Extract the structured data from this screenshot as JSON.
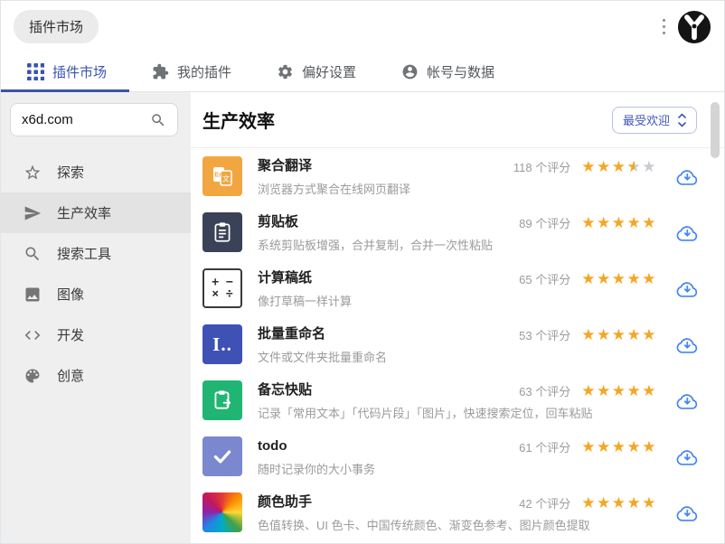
{
  "colors": {
    "accent_blue": "#3A55AD",
    "sort_blue": "#4059B8",
    "star_orange": "#F5A623",
    "star_gray": "#C8CBD0",
    "cloud_blue": "#4285F4",
    "sidebar_bg": "#EFEFEF",
    "sidebar_active_bg": "#E3E3E3"
  },
  "header": {
    "title_pill": "插件市场",
    "menu_icon": "kebab-menu-icon",
    "logo_icon": "brand-logo-icon"
  },
  "tabs": [
    {
      "label": "插件市场",
      "icon": "grid-icon",
      "active": true
    },
    {
      "label": "我的插件",
      "icon": "puzzle-icon",
      "active": false
    },
    {
      "label": "偏好设置",
      "icon": "gear-icon",
      "active": false
    },
    {
      "label": "帐号与数据",
      "icon": "account-icon",
      "active": false
    }
  ],
  "sidebar": {
    "search": {
      "value": "x6d.com",
      "icon": "search-icon"
    },
    "items": [
      {
        "label": "探索",
        "icon": "star-outline-icon",
        "active": false
      },
      {
        "label": "生产效率",
        "icon": "send-icon",
        "active": true
      },
      {
        "label": "搜索工具",
        "icon": "search-icon",
        "active": false
      },
      {
        "label": "图像",
        "icon": "image-icon",
        "active": false
      },
      {
        "label": "开发",
        "icon": "code-icon",
        "active": false
      },
      {
        "label": "创意",
        "icon": "palette-icon",
        "active": false
      }
    ]
  },
  "content": {
    "heading": "生产效率",
    "sort": {
      "label": "最受欢迎",
      "icon": "updown-chevron-icon"
    },
    "plugins": [
      {
        "name": "聚合翻译",
        "desc": "浏览器方式聚合在线网页翻译",
        "ratings": "118 个评分",
        "stars": 3.5,
        "icon": "translate-icon",
        "icon_bg": "#F2A640"
      },
      {
        "name": "剪贴板",
        "desc": "系统剪贴板增强，合并复制，合并一次性粘贴",
        "ratings": "89 个评分",
        "stars": 5,
        "icon": "clipboard-icon",
        "icon_bg": "#3A4257"
      },
      {
        "name": "计算稿纸",
        "desc": "像打草稿一样计算",
        "ratings": "65 个评分",
        "stars": 5,
        "icon": "calculator-icon",
        "icon_bg": "#FFFFFF"
      },
      {
        "name": "批量重命名",
        "desc": "文件或文件夹批量重命名",
        "ratings": "53 个评分",
        "stars": 5,
        "icon": "rename-icon",
        "icon_bg": "#3F51B5"
      },
      {
        "name": "备忘快贴",
        "desc": "记录「常用文本」「代码片段」「图片」，快速搜索定位，回车粘贴",
        "ratings": "63 个评分",
        "stars": 5,
        "icon": "memo-clipboard-icon",
        "icon_bg": "#21B573"
      },
      {
        "name": "todo",
        "desc": "随时记录你的大小事务",
        "ratings": "61 个评分",
        "stars": 5,
        "icon": "checkmark-icon",
        "icon_bg": "#7B87CE"
      },
      {
        "name": "颜色助手",
        "desc": "色值转换、UI 色卡、中国传统颜色、渐变色参考、图片颜色提取",
        "ratings": "42 个评分",
        "stars": 5,
        "icon": "color-wheel-icon",
        "icon_bg": "conic"
      }
    ]
  }
}
